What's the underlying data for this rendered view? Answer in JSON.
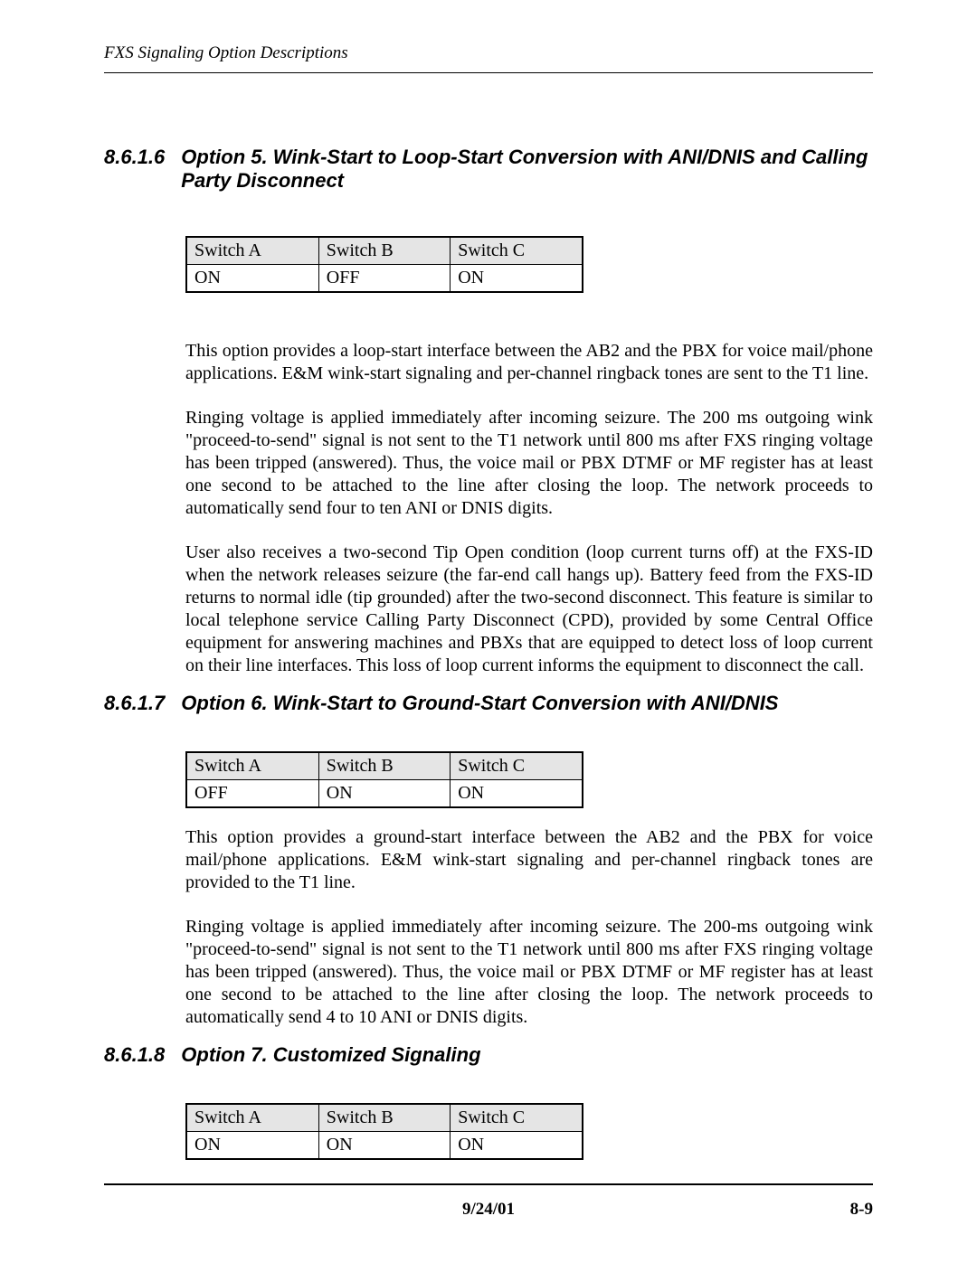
{
  "header": {
    "running_title": "FXS Signaling Option Descriptions"
  },
  "sections": [
    {
      "number": "8.6.1.6",
      "title": "Option 5. Wink-Start to Loop-Start Conversion with ANI/DNIS and Calling Party Disconnect",
      "table": {
        "headers": [
          "Switch A",
          "Switch B",
          "Switch C"
        ],
        "row": [
          "ON",
          "OFF",
          "ON"
        ]
      },
      "paragraphs": [
        "This option provides a loop-start interface between the AB2 and the PBX for voice mail/phone applications. E&M wink-start signaling and per-channel ringback tones are sent to the T1 line.",
        "Ringing voltage is applied immediately after incoming seizure. The 200 ms outgoing wink \"proceed-to-send\" signal is not sent to the T1 network until 800 ms after FXS ringing voltage has been tripped (answered).  Thus, the voice mail or PBX DTMF or MF register has at least one second to be attached to the line after closing the loop.  The network proceeds to automatically send four to ten ANI or DNIS digits.",
        "User also receives a two-second Tip Open condition (loop current turns off) at the FXS-ID when the network releases seizure (the far-end call hangs up).  Battery feed from the FXS-ID returns to normal idle (tip grounded) after the two-second disconnect.  This feature is similar to local telephone service Calling Party Disconnect (CPD), provided by some Central Office equipment for answering machines and PBXs that are equipped to detect loss of loop current on their line interfaces.  This loss of loop current informs the equipment to disconnect the call."
      ]
    },
    {
      "number": "8.6.1.7",
      "title": "Option 6. Wink-Start to Ground-Start Conversion with ANI/DNIS",
      "table": {
        "headers": [
          "Switch A",
          "Switch B",
          "Switch C"
        ],
        "row": [
          "OFF",
          "ON",
          "ON"
        ]
      },
      "paragraphs": [
        "This option provides a ground-start interface between the AB2 and the PBX for voice mail/phone applications.  E&M wink-start signaling and per-channel ringback tones are provided to the T1 line.",
        "Ringing voltage is applied immediately after incoming seizure.  The  200-ms outgoing wink \"proceed-to-send\" signal is not sent to the T1 network until 800 ms after FXS ringing voltage has been tripped (answered).  Thus, the voice mail or PBX DTMF or MF register has at least one second to be attached to the line after closing the loop.  The network proceeds to automatically send 4 to 10 ANI or DNIS digits."
      ]
    },
    {
      "number": "8.6.1.8",
      "title": "Option 7. Customized Signaling",
      "table": {
        "headers": [
          "Switch A",
          "Switch B",
          "Switch C"
        ],
        "row": [
          "ON",
          "ON",
          "ON"
        ]
      },
      "paragraphs": []
    }
  ],
  "footer": {
    "date": "9/24/01",
    "page": "8-9"
  }
}
